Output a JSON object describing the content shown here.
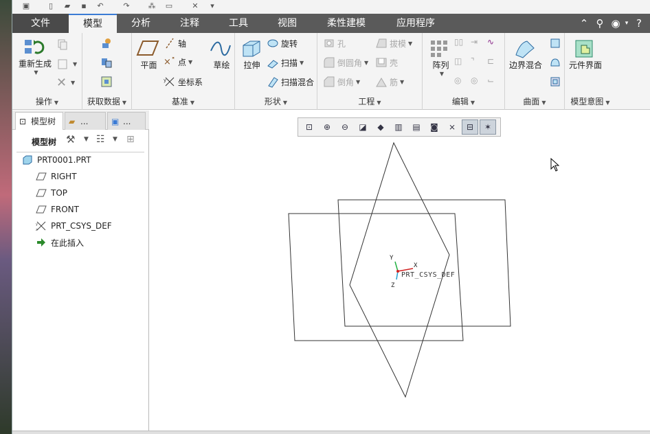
{
  "tabs": [
    "文件",
    "模型",
    "分析",
    "注释",
    "工具",
    "视图",
    "柔性建模",
    "应用程序"
  ],
  "active_tab": "模型",
  "ribbon": {
    "ops": {
      "regenerate": "重新生成",
      "label": "操作"
    },
    "getdata": {
      "label": "获取数据"
    },
    "datum": {
      "plane": "平面",
      "axis": "轴",
      "point": "点",
      "csys": "坐标系",
      "sketch": "草绘",
      "label": "基准"
    },
    "shape": {
      "extrude": "拉伸",
      "revolve": "旋转",
      "sweep": "扫描",
      "swept_blend": "扫描混合",
      "label": "形状"
    },
    "engineering": {
      "hole": "孔",
      "draft": "拔模",
      "round": "倒圆角",
      "shell": "壳",
      "chamfer": "倒角",
      "rib": "筋",
      "label": "工程"
    },
    "edit": {
      "pattern": "阵列",
      "label": "编辑"
    },
    "surface": {
      "boundary_blend": "边界混合",
      "label": "曲面"
    },
    "intent": {
      "component_interface": "元件界面",
      "label": "模型意图"
    }
  },
  "panel": {
    "tab_model_tree": "模型树",
    "tab2": "...",
    "tab3": "...",
    "toolbar_label": "模型树",
    "tree": [
      {
        "label": "PRT0001.PRT",
        "icon": "part-icon"
      },
      {
        "label": "RIGHT",
        "icon": "datum-plane-icon"
      },
      {
        "label": "TOP",
        "icon": "datum-plane-icon"
      },
      {
        "label": "FRONT",
        "icon": "datum-plane-icon"
      },
      {
        "label": "PRT_CSYS_DEF",
        "icon": "csys-icon"
      },
      {
        "label": "在此插入",
        "icon": "insert-here-arrow-icon"
      }
    ]
  },
  "viewport": {
    "csys_label": "PRT_CSYS_DEF",
    "axis_x": "X",
    "axis_y": "Y",
    "axis_z": "Z"
  }
}
